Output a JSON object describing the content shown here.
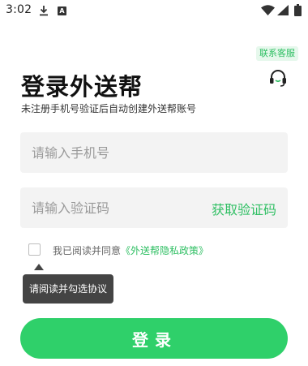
{
  "status_bar": {
    "time": "3:02"
  },
  "header": {
    "contact_label": "联系客服",
    "title": "登录外送帮",
    "subtitle": "未注册手机号验证后自动创建外送帮账号"
  },
  "form": {
    "phone_placeholder": "请输入手机号",
    "code_placeholder": "请输入验证码",
    "get_code_label": "获取验证码",
    "agree_prefix": "我已阅读并同意",
    "agree_link": "《外送帮隐私政策》",
    "agree_checked": false,
    "tooltip": "请阅读并勾选协议",
    "login_label": "登录"
  },
  "colors": {
    "accent": "#2fd06a",
    "accent_text": "#2fbf63",
    "input_bg": "#f3f3f3"
  },
  "icons": [
    "download-icon",
    "a-icon",
    "wifi-icon",
    "signal-icon",
    "battery-icon",
    "headset-icon"
  ]
}
